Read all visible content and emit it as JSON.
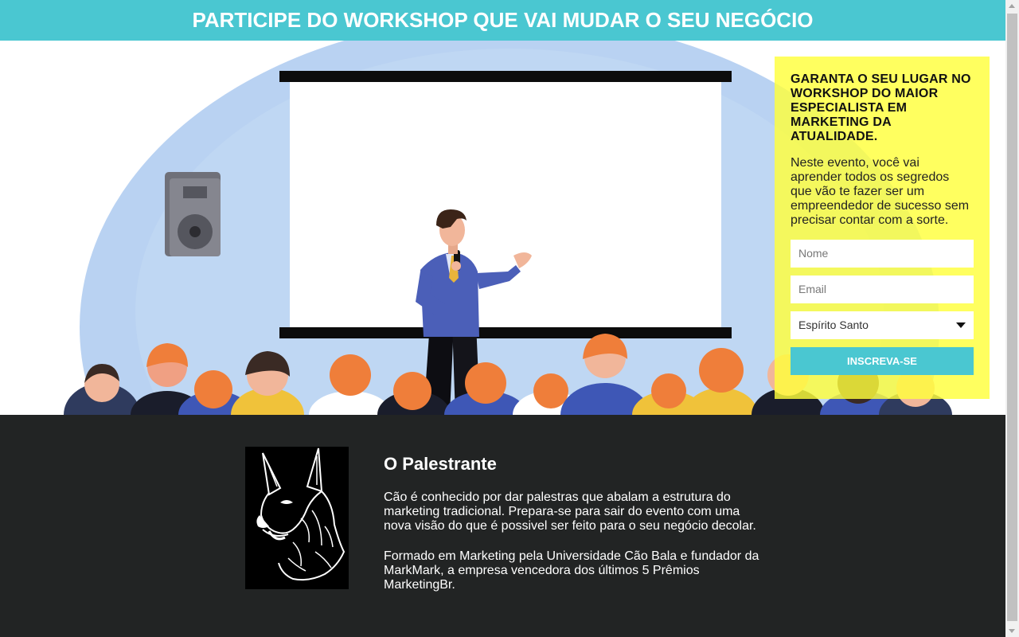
{
  "header": {
    "title": "PARTICIPE DO WORKSHOP QUE VAI MUDAR O SEU NEGÓCIO"
  },
  "hero": {
    "illustration": "presenter-on-stage-illustration"
  },
  "form": {
    "heading": "GARANTA O SEU LUGAR NO WORKSHOP DO MAIOR ESPECIALISTA EM MARKETING DA ATUALIDADE.",
    "description": "Neste evento, você vai aprender todos os segredos que vão te fazer ser um empreendedor de sucesso sem precisar contar com a sorte.",
    "name_placeholder": "Nome",
    "email_placeholder": "Email",
    "state_selected": "Espírito Santo",
    "submit_label": "INSCREVA-SE"
  },
  "speaker": {
    "photo": "dog-portrait",
    "title": "O Palestrante",
    "paragraph1": "Cão é conhecido por dar palestras que abalam a estrutura do marketing tradicional. Prepara-se para sair do evento com uma nova visão do que é possivel ser feito para o seu negócio decolar.",
    "paragraph2": "Formado em Marketing pela Universidade Cão Bala e fundador da MarkMark, a empresa vencedora dos últimos 5 Prêmios MarketingBr."
  },
  "colors": {
    "accent": "#4ac7d1",
    "form_bg": "#ffff3c",
    "dark_bg": "#222424"
  }
}
